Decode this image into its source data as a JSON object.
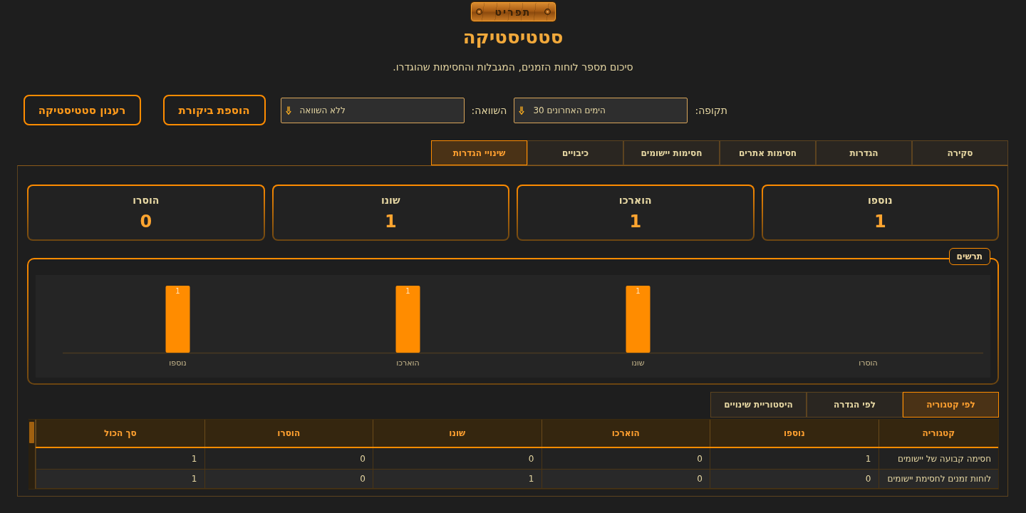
{
  "menu_button": {
    "label": "תפריט"
  },
  "header": {
    "title": "סטטיסטיקה",
    "subtitle": "סיכום מספר לוחות הזמנים, המגבלות והחסימות שהוגדרו."
  },
  "filters": [
    {
      "label": "תקופה:",
      "value": "30 הימים האחרונים"
    },
    {
      "label": "השוואה:",
      "value": "ללא השוואה"
    }
  ],
  "buttons": [
    "הוספת ביקורת",
    "רענון סטטיסטיקה"
  ],
  "tabs": [
    {
      "label": "סקירה",
      "selected": false
    },
    {
      "label": "הגדרות",
      "selected": false
    },
    {
      "label": "חסימות אתרים",
      "selected": false
    },
    {
      "label": "חסימות יישומים",
      "selected": false
    },
    {
      "label": "כיבויים",
      "selected": false
    },
    {
      "label": "שינויי הגדרות",
      "selected": true
    }
  ],
  "summary_cards": [
    {
      "label": "נוספו",
      "value": "1"
    },
    {
      "label": "הוארכו",
      "value": "1"
    },
    {
      "label": "שונו",
      "value": "1"
    },
    {
      "label": "הוסרו",
      "value": "0"
    }
  ],
  "chart": {
    "chart_data": {
      "type": "bar",
      "title": "תרשים",
      "categories": [
        "נוספו",
        "הוארכו",
        "שונו",
        "הוסרו"
      ],
      "series": [
        {
          "color": "#ff8c00",
          "values": [
            1,
            1,
            1,
            null
          ]
        }
      ],
      "data_labels": true
    }
  },
  "sub_tabs": [
    {
      "label": "לפי קטגוריה",
      "selected": true
    },
    {
      "label": "לפי הגדרה",
      "selected": false
    },
    {
      "label": "היסטוריית שינויים",
      "selected": false
    }
  ],
  "table": {
    "columns": [
      "קטגוריה",
      "נוספו",
      "הוארכו",
      "שונו",
      "הוסרו",
      "סך הכול"
    ],
    "rows": [
      [
        "חסימה קבועה של יישומים",
        "1",
        "0",
        "0",
        "0",
        "1"
      ],
      [
        "לוחות זמנים לחסימת יישומים",
        "0",
        "0",
        "1",
        "0",
        "1"
      ]
    ]
  }
}
